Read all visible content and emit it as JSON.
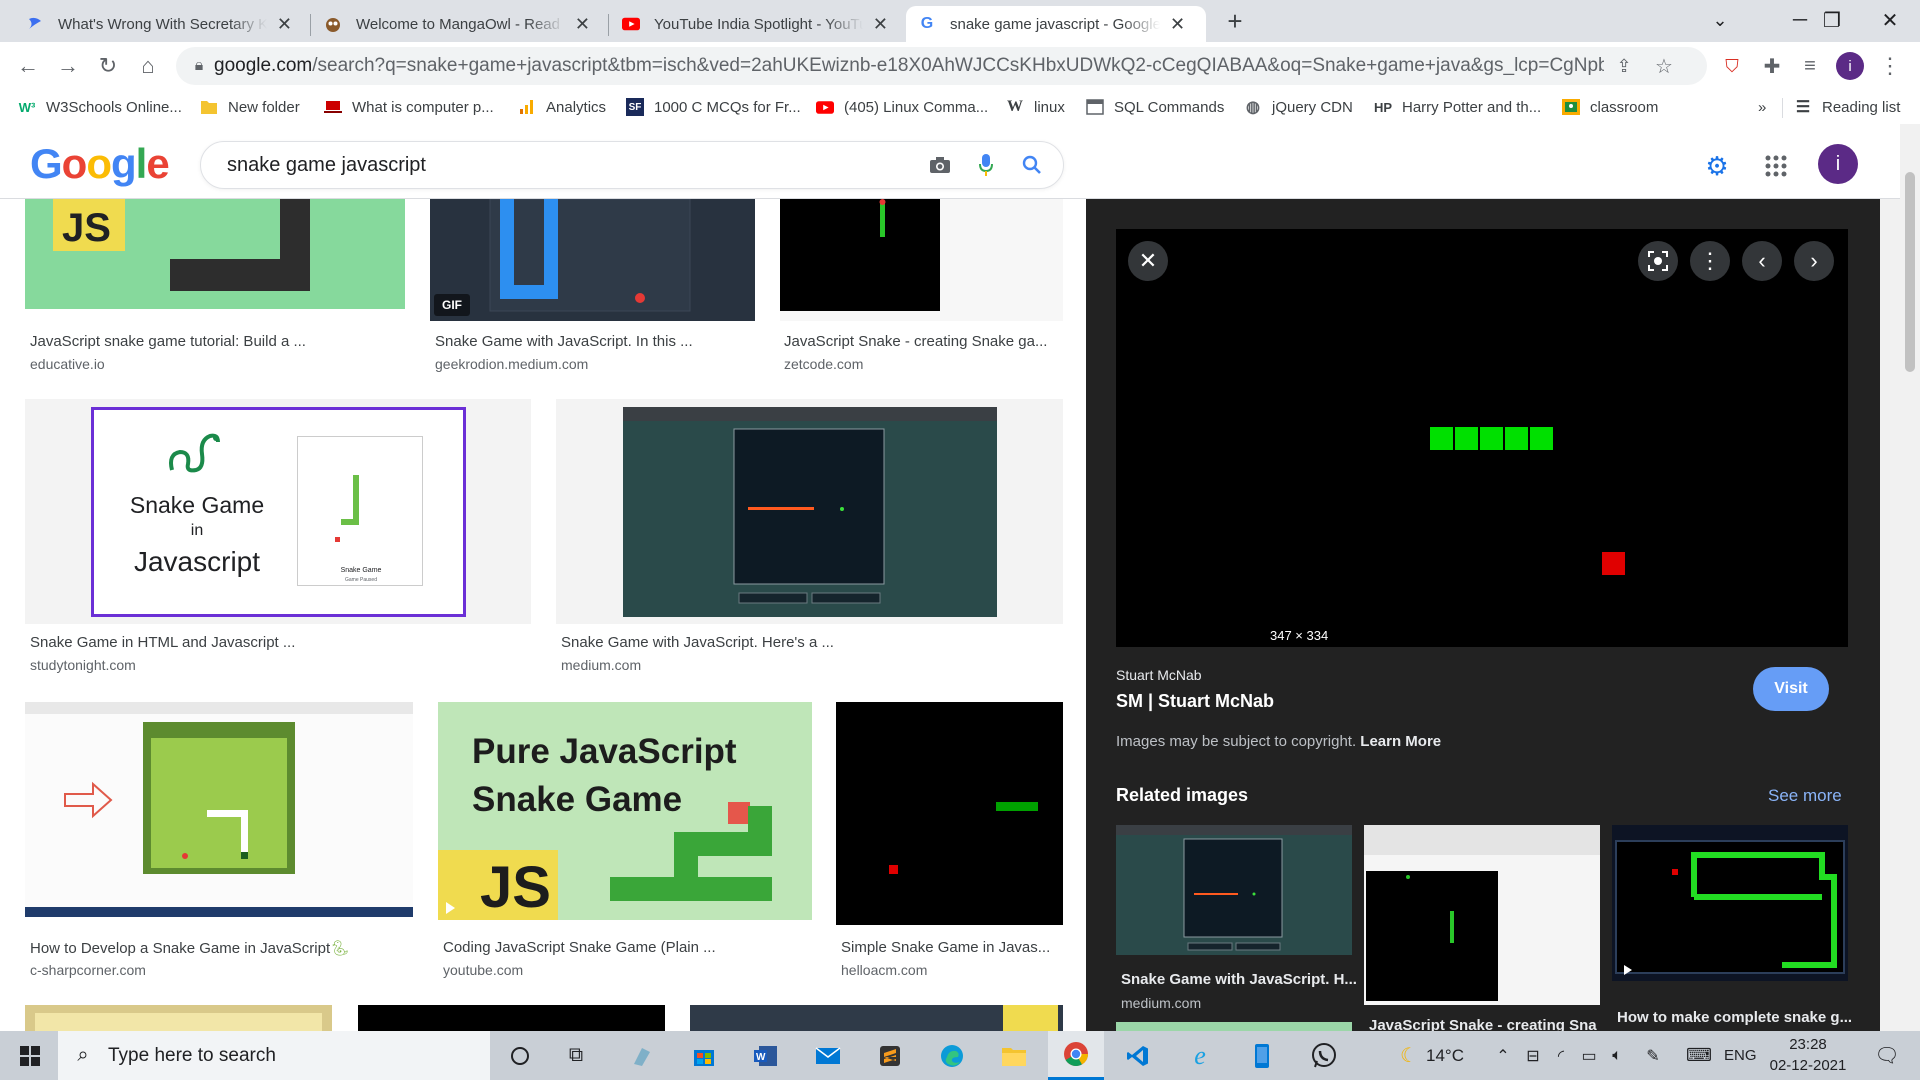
{
  "tabs": [
    {
      "title": "What's Wrong With Secretary Kim",
      "favicon_color": "#3c6ff0"
    },
    {
      "title": "Welcome to MangaOwl - Read manga",
      "favicon_color": "#8a5a2b"
    },
    {
      "title": "YouTube India Spotlight - YouTube",
      "favicon_color": "#ff0000"
    },
    {
      "title": "snake game javascript - Google Search",
      "favicon_color": "#4285f4",
      "active": true
    }
  ],
  "omnibox": {
    "url_domain": "google.com",
    "url_rest": "/search?q=snake+game+javascript&tbm=isch&ved=2ahUKEwiznb-e18X0AhWJCCsKHbxUDWkQ2-cCegQIABAA&oq=Snake+game+java&gs_lcp=CgNpbWcQARgDMg..."
  },
  "bookmarks": [
    {
      "label": "W3Schools Online...",
      "icon": "w3-icon",
      "color": "#04aa6d",
      "glyph": "W"
    },
    {
      "label": "New folder",
      "icon": "folder-icon",
      "color": "#f4c430",
      "glyph": ""
    },
    {
      "label": "What is computer p...",
      "icon": "laptop-icon",
      "color": "#cc0000",
      "glyph": ""
    },
    {
      "label": "Analytics",
      "icon": "analytics-icon",
      "color": "#f9ab00",
      "glyph": ""
    },
    {
      "label": "1000 C MCQs for Fr...",
      "icon": "sanfoundry-icon",
      "color": "#1a2a5a",
      "glyph": "S"
    },
    {
      "label": "(405) Linux Comma...",
      "icon": "youtube-icon",
      "color": "#ff0000",
      "glyph": "▶"
    },
    {
      "label": "linux",
      "icon": "wikipedia-icon",
      "color": "#202124",
      "glyph": "W"
    },
    {
      "label": "SQL Commands",
      "icon": "page-icon",
      "color": "#5f6368",
      "glyph": ""
    },
    {
      "label": "jQuery CDN",
      "icon": "globe-icon",
      "color": "#5f6368",
      "glyph": "◍"
    },
    {
      "label": "Harry Potter and th...",
      "icon": "hp-icon",
      "color": "#202124",
      "glyph": "HP"
    },
    {
      "label": "classroom",
      "icon": "classroom-icon",
      "color": "#f9ab00",
      "glyph": ""
    }
  ],
  "bookmarks_more": "»",
  "reading_list": "Reading list",
  "search": {
    "query": "snake game javascript"
  },
  "logo": [
    "G",
    "o",
    "o",
    "g",
    "l",
    "e"
  ],
  "account_initial": "i",
  "results": [
    {
      "title": "JavaScript snake game tutorial: Build a ...",
      "source": "educative.io"
    },
    {
      "title": "Snake Game with JavaScript. In this ...",
      "source": "geekrodion.medium.com",
      "badge": "GIF"
    },
    {
      "title": "JavaScript Snake - creating Snake ga...",
      "source": "zetcode.com"
    },
    {
      "title": "Snake Game in HTML and Javascript ...",
      "source": "studytonight.com",
      "img_text": [
        "Snake Game",
        "in",
        "Javascript",
        "Snake Game",
        "Game Paused"
      ]
    },
    {
      "title": "Snake Game with JavaScript. Here's a ...",
      "source": "medium.com"
    },
    {
      "title": "How to Develop a Snake Game in JavaScript",
      "source": "c-sharpcorner.com"
    },
    {
      "title": "Coding JavaScript Snake Game (Plain ...",
      "source": "youtube.com",
      "img_text": [
        "Pure JavaScript",
        "Snake Game",
        "JS"
      ]
    },
    {
      "title": "Simple Snake Game in Javas...",
      "source": "helloacm.com"
    }
  ],
  "preview": {
    "dimensions": "347 × 334",
    "site": "Stuart McNab",
    "title": "SM | Stuart McNab",
    "visit_label": "Visit",
    "copyright": "Images may be subject to copyright.",
    "learn_more": "Learn More",
    "related_heading": "Related images",
    "see_more": "See more",
    "related": [
      {
        "title": "Snake Game with JavaScript. H...",
        "source": "medium.com"
      },
      {
        "title": "JavaScript Snake - creating Sna",
        "source": ""
      },
      {
        "title": "How to make complete snake g...",
        "source": ""
      }
    ]
  },
  "taskbar": {
    "search_placeholder": "Type here to search",
    "weather": "14°C",
    "language": "ENG",
    "time": "23:28",
    "date": "02-12-2021"
  },
  "colors": {
    "google_blue": "#4285f4",
    "google_red": "#ea4335",
    "google_yellow": "#fbbc05",
    "google_green": "#34a853",
    "snake_green": "#00e000",
    "apple_red": "#e00000"
  }
}
